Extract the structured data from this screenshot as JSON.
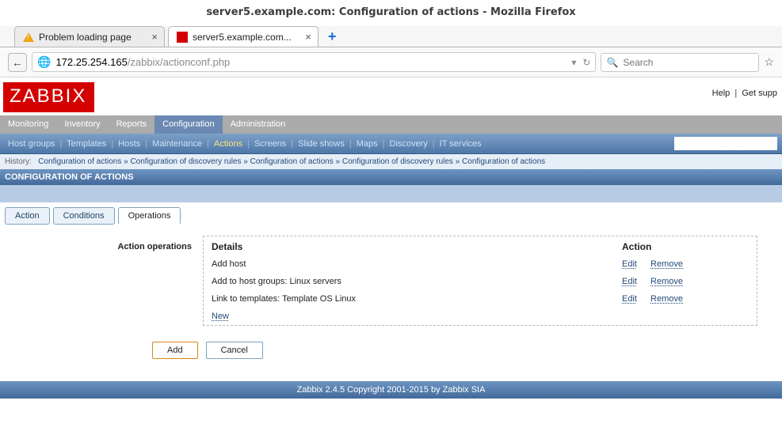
{
  "browser": {
    "window_title": "server5.example.com: Configuration of actions - Mozilla Firefox",
    "tabs": [
      {
        "label": "Problem loading page",
        "active": false
      },
      {
        "label": "server5.example.com...",
        "active": true
      }
    ],
    "url_host": "172.25.254.165",
    "url_path": "/zabbix/actionconf.php",
    "search_placeholder": "Search",
    "star_icon": "☆"
  },
  "toplinks": {
    "help": "Help",
    "getsupport": "Get supp"
  },
  "logo": "ZABBIX",
  "mainnav": [
    "Monitoring",
    "Inventory",
    "Reports",
    "Configuration",
    "Administration"
  ],
  "mainnav_active": "Configuration",
  "subnav": [
    "Host groups",
    "Templates",
    "Hosts",
    "Maintenance",
    "Actions",
    "Screens",
    "Slide shows",
    "Maps",
    "Discovery",
    "IT services"
  ],
  "subnav_active": "Actions",
  "breadcrumb": {
    "label": "History:",
    "items": [
      "Configuration of actions",
      "Configuration of discovery rules",
      "Configuration of actions",
      "Configuration of discovery rules",
      "Configuration of actions"
    ]
  },
  "page_title": "CONFIGURATION OF ACTIONS",
  "tabs": [
    {
      "key": "action",
      "label": "Action"
    },
    {
      "key": "conditions",
      "label": "Conditions"
    },
    {
      "key": "operations",
      "label": "Operations"
    }
  ],
  "tabs_active": "operations",
  "form_label": "Action operations",
  "ops_header_details": "Details",
  "ops_header_action": "Action",
  "ops_edit": "Edit",
  "ops_remove": "Remove",
  "ops_new": "New",
  "ops": [
    {
      "details": "Add host"
    },
    {
      "details": "Add to host groups: Linux servers"
    },
    {
      "details": "Link to templates: Template OS Linux"
    }
  ],
  "buttons": {
    "add": "Add",
    "cancel": "Cancel"
  },
  "footer": "Zabbix 2.4.5 Copyright 2001-2015 by Zabbix SIA"
}
